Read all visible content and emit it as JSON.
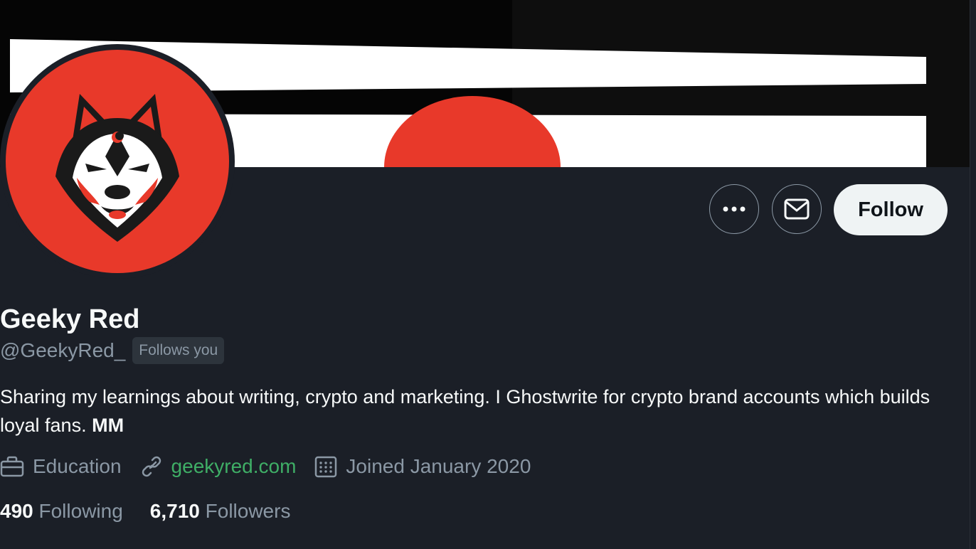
{
  "profile": {
    "display_name": "Geeky Red",
    "handle": "@GeekyRed_",
    "follows_you_badge": "Follows you",
    "bio_text": "Sharing my learnings about writing, crypto and marketing. I Ghostwrite for crypto brand accounts which builds loyal fans. ",
    "bio_bold": "MM",
    "category": "Education",
    "website": "geekyred.com",
    "joined": "Joined January 2020",
    "following_count": "490",
    "following_label": "Following",
    "followers_count": "6,710",
    "followers_label": "Followers"
  },
  "actions": {
    "follow_label": "Follow",
    "more_icon": "more-icon",
    "message_icon": "mail-icon"
  },
  "colors": {
    "background": "#1b1f27",
    "accent_red": "#e8392a",
    "link_green": "#3fae66",
    "muted_text": "#8b98a5"
  }
}
